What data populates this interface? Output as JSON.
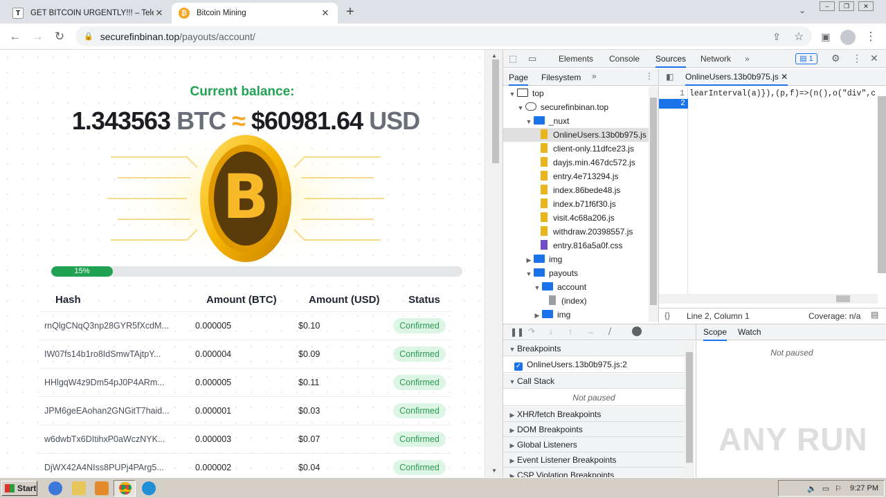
{
  "browser": {
    "tabs": [
      {
        "title": "GET BITCOIN URGENTLY!!! – Telegra",
        "favicon": "T"
      },
      {
        "title": "Bitcoin Mining",
        "favicon": "₿"
      }
    ],
    "new_tab": "+",
    "url_host": "securefinbinan.top",
    "url_path": "/payouts/account/"
  },
  "page": {
    "balance_title": "Current balance:",
    "btc_amount": "1.343563",
    "btc_unit": "BTC",
    "approx": "≈",
    "usd_amount": "$60981.64",
    "usd_unit": "USD",
    "progress_label": "15%",
    "progress_value": 15,
    "table": {
      "headers": [
        "Hash",
        "Amount (BTC)",
        "Amount (USD)",
        "Status"
      ],
      "rows": [
        [
          "rnQlgCNqQ3np28GYR5fXcdM...",
          "0.000005",
          "$0.10",
          "Confirmed"
        ],
        [
          "IW07fs14b1ro8IdSmwTAjtpY...",
          "0.000004",
          "$0.09",
          "Confirmed"
        ],
        [
          "HHlgqW4z9Dm54pJ0P4ARm...",
          "0.000005",
          "$0.11",
          "Confirmed"
        ],
        [
          "JPM6geEAohan2GNGitT7haid...",
          "0.000001",
          "$0.03",
          "Confirmed"
        ],
        [
          "w6dwbTx6DItihxP0aWczNYK...",
          "0.000003",
          "$0.07",
          "Confirmed"
        ],
        [
          "DjWX42A4NIss8PUPj4PArg5...",
          "0.000002",
          "$0.04",
          "Confirmed"
        ]
      ]
    }
  },
  "devtools": {
    "tabs": [
      "Elements",
      "Console",
      "Sources",
      "Network"
    ],
    "active_tab": "Sources",
    "more": "»",
    "issues_count": "1",
    "nav_tabs": [
      "Page",
      "Filesystem"
    ],
    "tree": [
      {
        "label": "top",
        "kind": "frame",
        "arrow": "▼"
      },
      {
        "label": "securefinbinan.top",
        "kind": "cloud",
        "arrow": "▼"
      },
      {
        "label": "_nuxt",
        "kind": "folder",
        "arrow": "▼"
      },
      {
        "label": "OnlineUsers.13b0b975.js",
        "kind": "js"
      },
      {
        "label": "client-only.11dfce23.js",
        "kind": "js"
      },
      {
        "label": "dayjs.min.467dc572.js",
        "kind": "js"
      },
      {
        "label": "entry.4e713294.js",
        "kind": "js"
      },
      {
        "label": "index.86bede48.js",
        "kind": "js"
      },
      {
        "label": "index.b71f6f30.js",
        "kind": "js"
      },
      {
        "label": "visit.4c68a206.js",
        "kind": "js"
      },
      {
        "label": "withdraw.20398557.js",
        "kind": "js"
      },
      {
        "label": "entry.816a5a0f.css",
        "kind": "css"
      },
      {
        "label": "img",
        "kind": "folder",
        "arrow": "▶"
      },
      {
        "label": "payouts",
        "kind": "folder",
        "arrow": "▼"
      },
      {
        "label": "account",
        "kind": "folder",
        "arrow": "▼"
      },
      {
        "label": "(index)",
        "kind": "doc"
      },
      {
        "label": "img",
        "kind": "folder",
        "arrow": "▶"
      }
    ],
    "editor_tab": "OnlineUsers.13b0b975.js",
    "code_line_1": "learInterval(a)}),(p,f)=>(n(),o(\"div\",c",
    "line_numbers": [
      "1",
      "2"
    ],
    "status_position": "Line 2, Column 1",
    "coverage": "Coverage: n/a",
    "breakpoints_header": "Breakpoints",
    "breakpoint_item": "OnlineUsers.13b0b975.js:2",
    "call_stack_header": "Call Stack",
    "not_paused": "Not paused",
    "sections": [
      "XHR/fetch Breakpoints",
      "DOM Breakpoints",
      "Global Listeners",
      "Event Listener Breakpoints",
      "CSP Violation Breakpoints"
    ],
    "scope_tabs": [
      "Scope",
      "Watch"
    ]
  },
  "taskbar": {
    "start": "Start",
    "clock": "9:27 PM"
  },
  "watermark": "ANY RUN",
  "colors": {
    "green": "#21a152",
    "bitcoin": "#f5a623",
    "devtools_blue": "#1a73e8"
  }
}
